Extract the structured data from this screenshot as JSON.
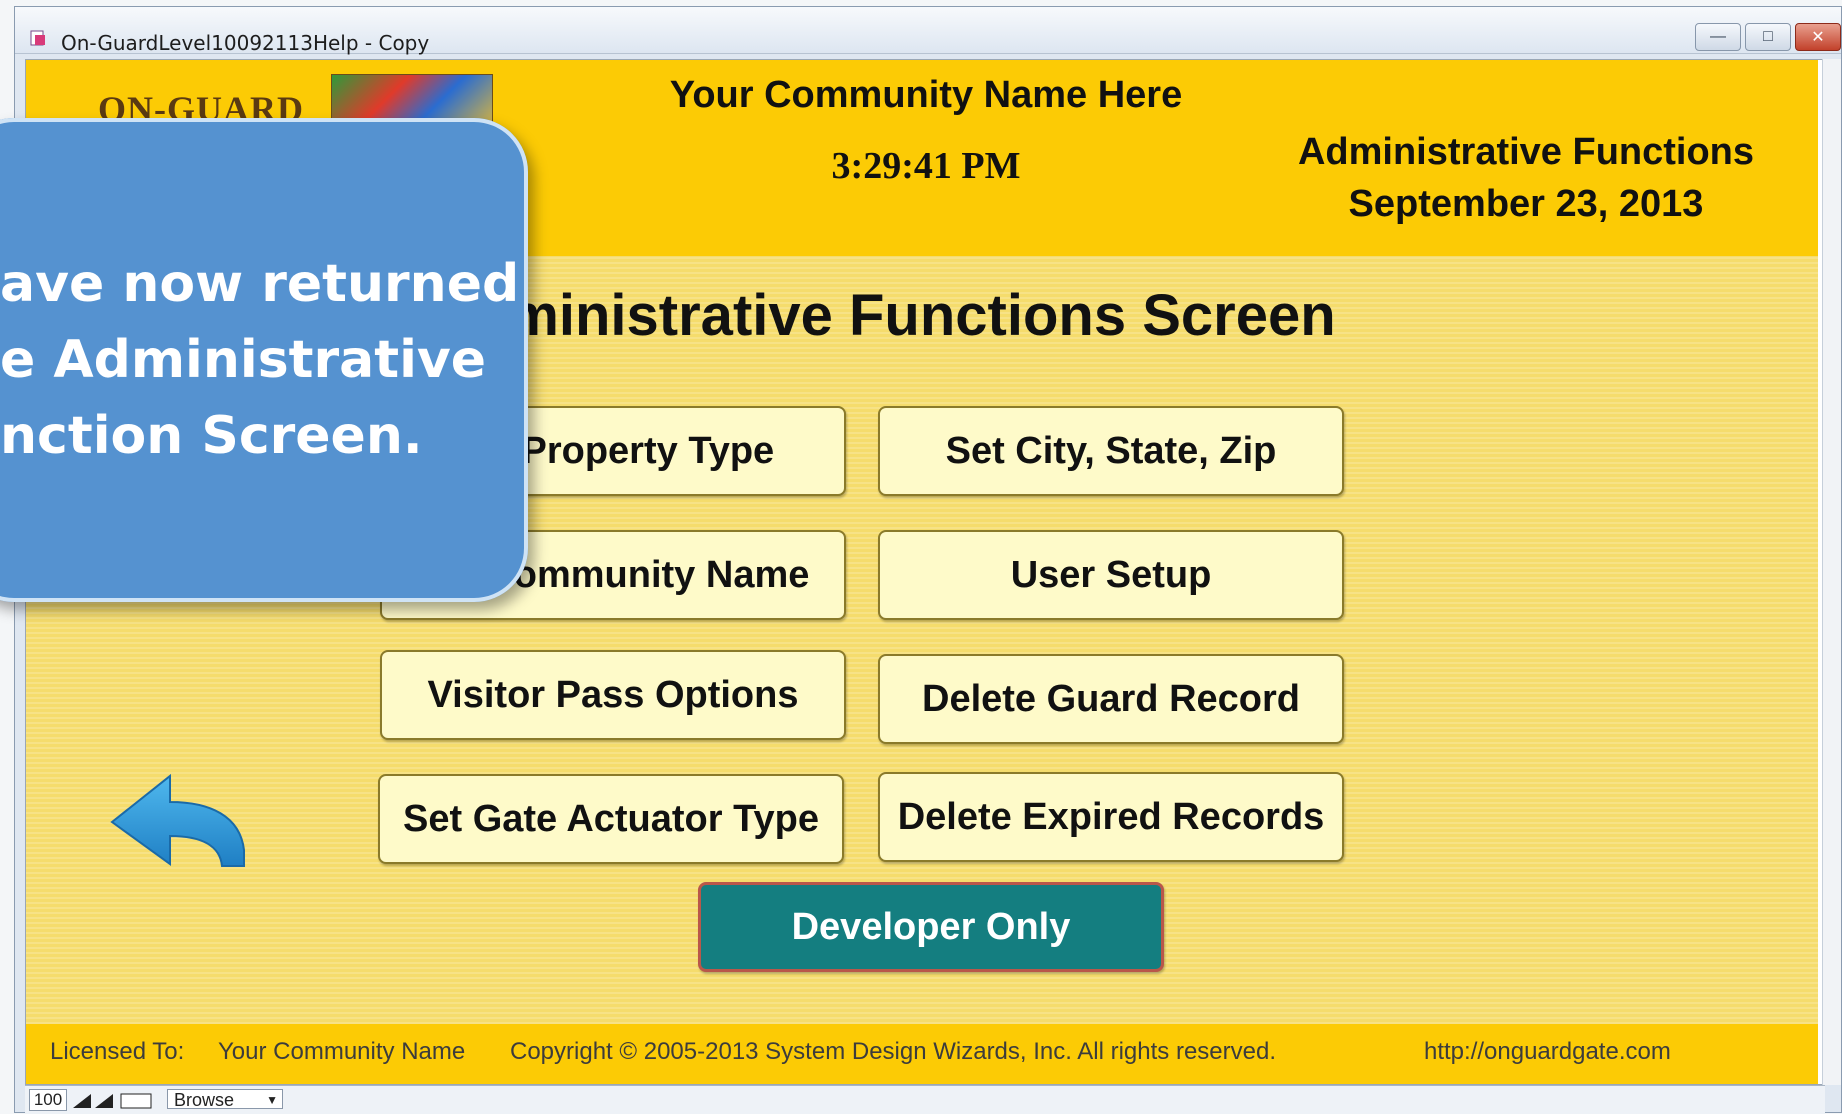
{
  "window": {
    "title": "On-GuardLevel10092113Help - Copy",
    "minimize_icon": "minimize-icon",
    "maximize_icon": "maximize-icon",
    "close_icon": "close-icon"
  },
  "header": {
    "logo_text": "ON-GUARD",
    "community_name": "Your Community Name Here",
    "time": "3:29:41 PM",
    "section_title": "Administrative Functions",
    "date": "September 23, 2013",
    "background_color": "#fccb05"
  },
  "screen": {
    "title": "Administrative Functions Screen"
  },
  "buttons": {
    "set_property_type": "Set Property Type",
    "set_city_state_zip": "Set City, State, Zip",
    "set_community_name": "Set Community Name",
    "user_setup": "User Setup",
    "visitor_pass_options": "Visitor Pass Options",
    "delete_guard_record": "Delete Guard Record",
    "set_gate_actuator_type": "Set Gate Actuator Type",
    "delete_expired_records": "Delete Expired Records",
    "developer_only": "Developer Only",
    "back_icon": "back-arrow-icon"
  },
  "footer": {
    "licensed_to_label": "Licensed To:",
    "licensed_to_value": "Your Community Name",
    "copyright": "Copyright © 2005-2013 System Design Wizards, Inc. All rights reserved.",
    "url": "http://onguardgate.com"
  },
  "statusbar": {
    "zoom": "100",
    "mode": "Browse"
  },
  "callout": {
    "lines": [
      "ave now returned",
      "e Administrative",
      "nction Screen."
    ],
    "color": "#5592d0"
  }
}
